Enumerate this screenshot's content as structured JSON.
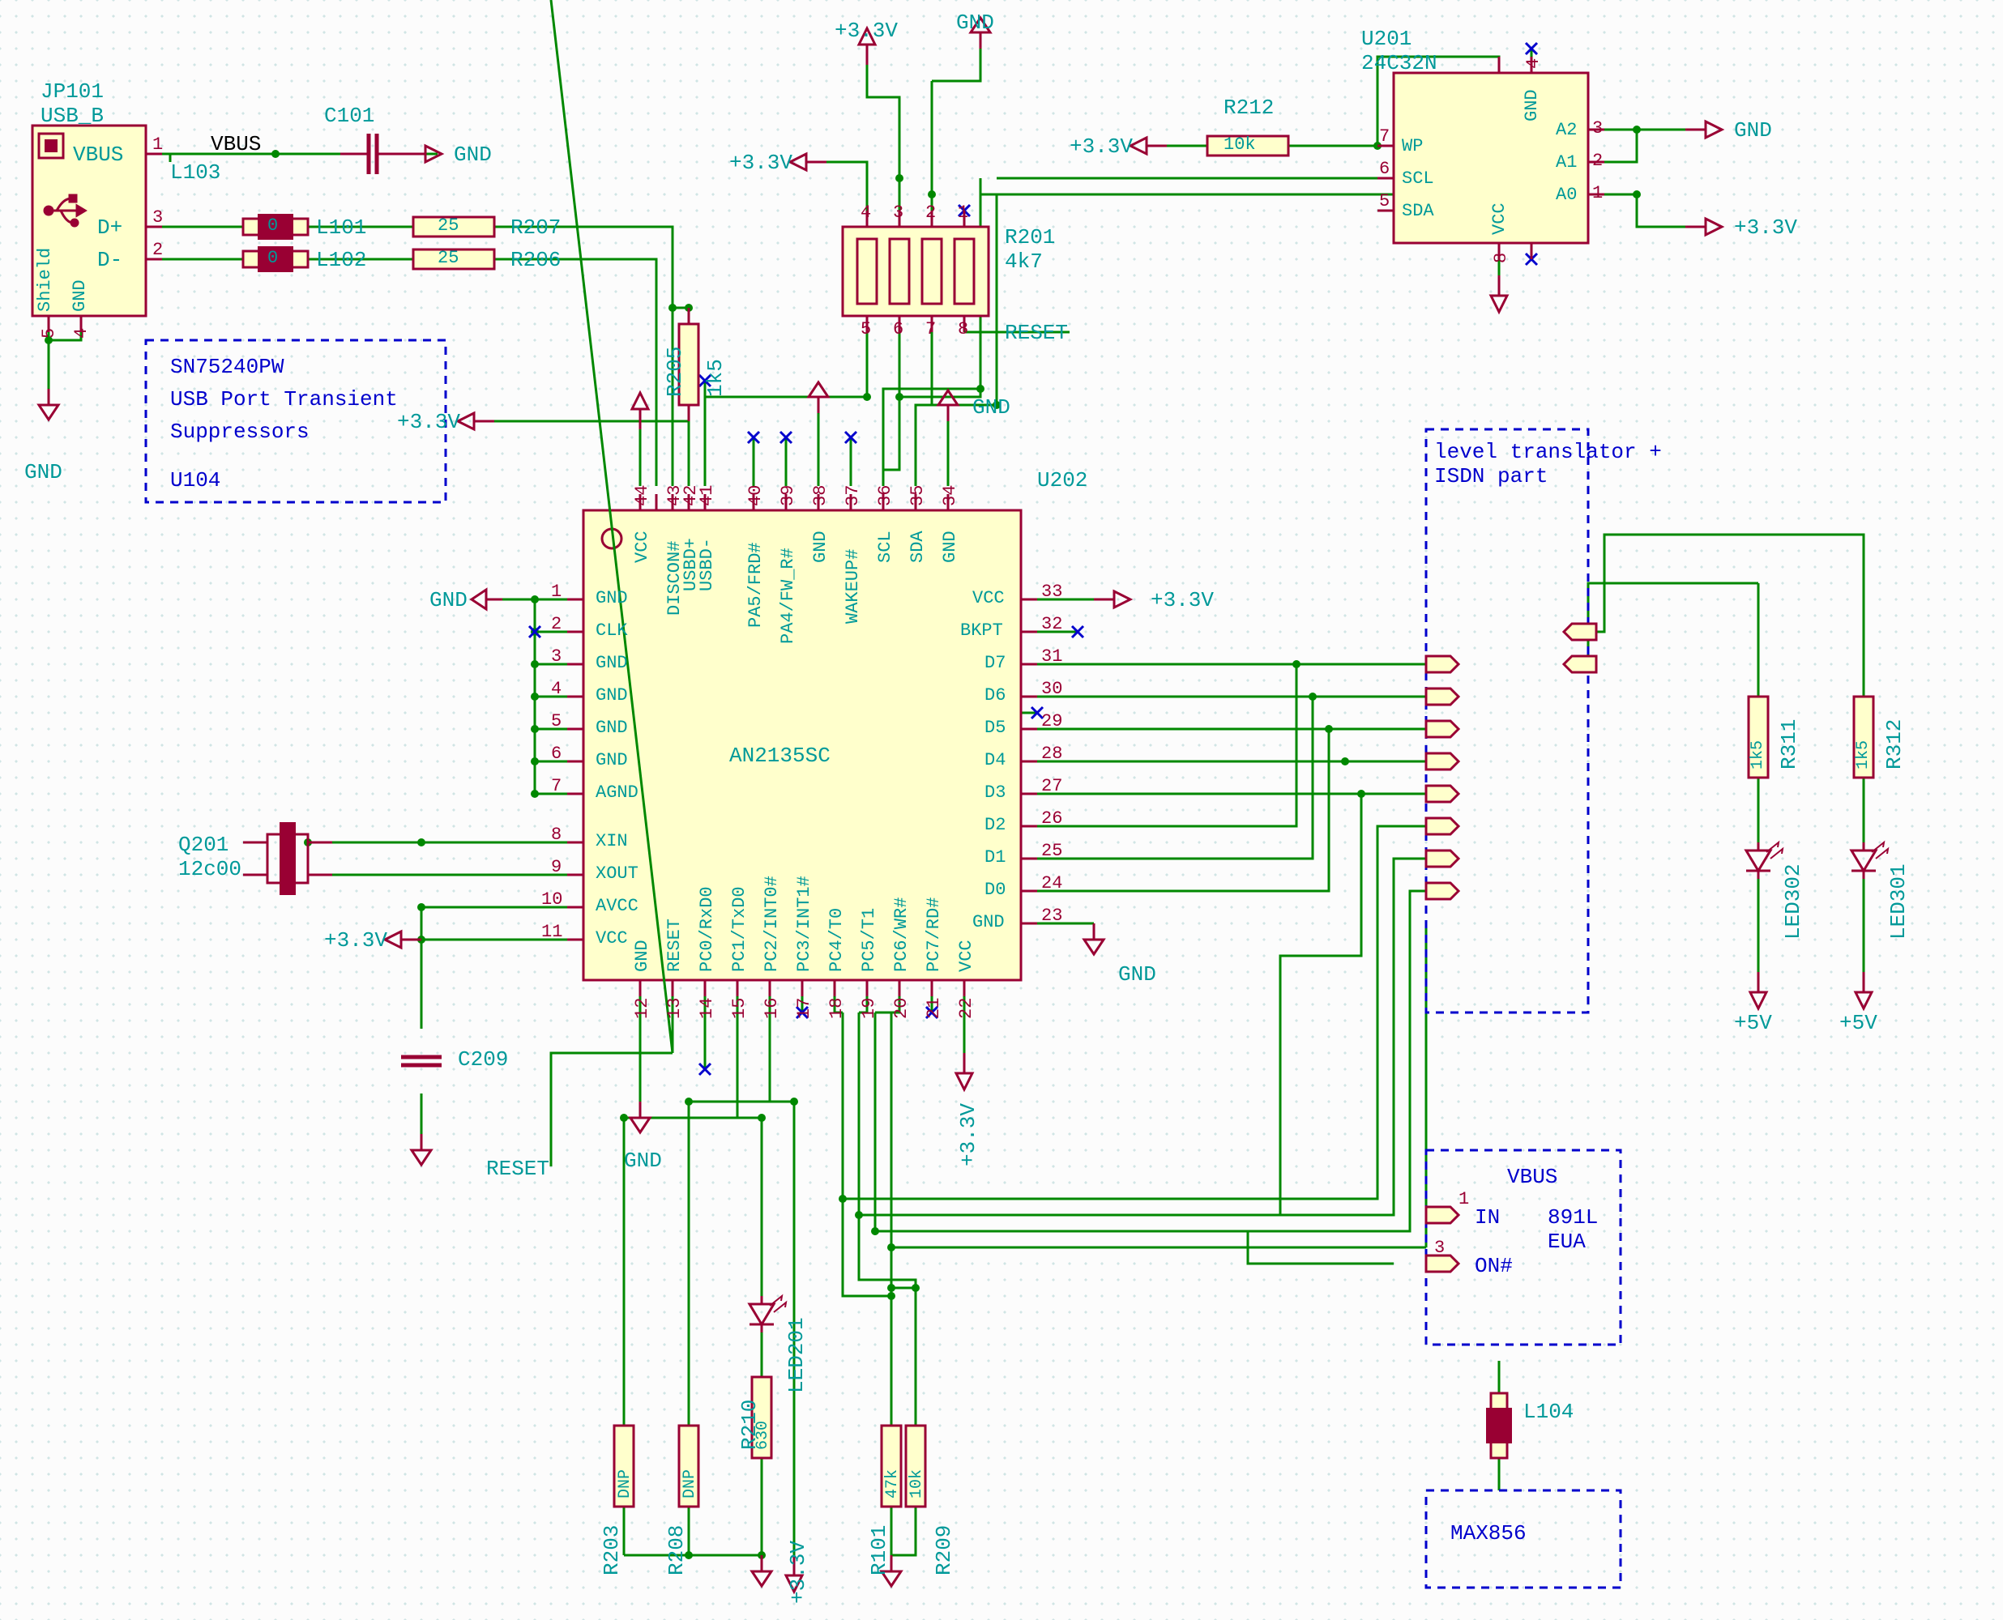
{
  "usb": {
    "ref": "JP101",
    "name": "USB_B",
    "pins": {
      "vbus": "VBUS",
      "dplus": "D+",
      "dminus": "D-",
      "shield": "Shield",
      "gnd": "GND"
    },
    "pinNums": {
      "vbus": "1",
      "dplus": "3",
      "dminus": "2",
      "shield": "5",
      "gnd": "4"
    },
    "gnd_label": "GND"
  },
  "nets": {
    "vbus": "VBUS",
    "reset": "RESET",
    "gnd": "GND",
    "v33": "+3.3V",
    "v5": "+5V"
  },
  "ferrites": {
    "l103": {
      "ref": "L103"
    },
    "l101": {
      "ref": "L101",
      "val": "0"
    },
    "l102": {
      "ref": "L102",
      "val": "0"
    },
    "l104": {
      "ref": "L104"
    }
  },
  "caps": {
    "c101": {
      "ref": "C101"
    },
    "c209": {
      "ref": "C209"
    }
  },
  "resistors": {
    "r207": {
      "ref": "R207",
      "val": "25"
    },
    "r206": {
      "ref": "R206",
      "val": "25"
    },
    "r205": {
      "ref": "R205",
      "val": "1k5"
    },
    "r212": {
      "ref": "R212",
      "val": "10k"
    },
    "r201": {
      "ref": "R201",
      "val": "4k7"
    },
    "r210": {
      "ref": "R210",
      "val": "630"
    },
    "r203": {
      "ref": "R203",
      "val": "DNP"
    },
    "r208": {
      "ref": "R208",
      "val": "DNP"
    },
    "r101": {
      "ref": "R101",
      "val": "47k"
    },
    "r209": {
      "ref": "R209",
      "val": "10k"
    },
    "r311": {
      "ref": "R311",
      "val": "1k5"
    },
    "r312": {
      "ref": "R312",
      "val": "1k5"
    }
  },
  "crystal": {
    "ref": "Q201",
    "val": "12c00"
  },
  "leds": {
    "led201": {
      "ref": "LED201"
    },
    "led302": {
      "ref": "LED302"
    },
    "led301": {
      "ref": "LED301"
    }
  },
  "u104_block": {
    "ref": "U104",
    "line1": "SN75240PW",
    "line2": "USB Port Transient",
    "line3": "Suppressors"
  },
  "level_block": {
    "line1": "level translator +",
    "line2": "ISDN part"
  },
  "u201": {
    "ref": "U201",
    "name": "24C32N",
    "pins": {
      "wp": {
        "name": "WP",
        "num": "7"
      },
      "scl": {
        "name": "SCL",
        "num": "6"
      },
      "sda": {
        "name": "SDA",
        "num": "5"
      },
      "vcc": {
        "name": "VCC",
        "num": "8"
      },
      "gnd": {
        "name": "GND",
        "num": "4"
      },
      "a0": {
        "name": "A0",
        "num": "1"
      },
      "a1": {
        "name": "A1",
        "num": "2"
      },
      "a2": {
        "name": "A2",
        "num": "3"
      }
    }
  },
  "u202": {
    "ref": "U202",
    "name": "AN2135SC",
    "top": {
      "p44": {
        "num": "44",
        "name": "VCC"
      },
      "p43": {
        "num": "43",
        "name": "DISCON#"
      },
      "p42": {
        "num": "42",
        "name": "USBD+"
      },
      "p41": {
        "num": "41",
        "name": "USBD-"
      },
      "p40": {
        "num": "40",
        "name": "PA5/FRD#"
      },
      "p39": {
        "num": "39",
        "name": "PA4/FW_R#"
      },
      "p38": {
        "num": "38",
        "name": "GND"
      },
      "p37": {
        "num": "37",
        "name": "WAKEUP#"
      },
      "p36": {
        "num": "36",
        "name": "SCL"
      },
      "p35": {
        "num": "35",
        "name": "SDA"
      },
      "p34": {
        "num": "34",
        "name": "GND"
      }
    },
    "left": {
      "p1": {
        "num": "1",
        "name": "GND"
      },
      "p2": {
        "num": "2",
        "name": "CLK"
      },
      "p3": {
        "num": "3",
        "name": "GND"
      },
      "p4": {
        "num": "4",
        "name": "GND"
      },
      "p5": {
        "num": "5",
        "name": "GND"
      },
      "p6": {
        "num": "6",
        "name": "GND"
      },
      "p7": {
        "num": "7",
        "name": "AGND"
      },
      "p8": {
        "num": "8",
        "name": "XIN"
      },
      "p9": {
        "num": "9",
        "name": "XOUT"
      },
      "p10": {
        "num": "10",
        "name": "AVCC"
      },
      "p11": {
        "num": "11",
        "name": "VCC"
      }
    },
    "right": {
      "p33": {
        "num": "33",
        "name": "VCC"
      },
      "p32": {
        "num": "32",
        "name": "BKPT"
      },
      "p31": {
        "num": "31",
        "name": "D7"
      },
      "p30": {
        "num": "30",
        "name": "D6"
      },
      "p29": {
        "num": "29",
        "name": "D5"
      },
      "p28": {
        "num": "28",
        "name": "D4"
      },
      "p27": {
        "num": "27",
        "name": "D3"
      },
      "p26": {
        "num": "26",
        "name": "D2"
      },
      "p25": {
        "num": "25",
        "name": "D1"
      },
      "p24": {
        "num": "24",
        "name": "D0"
      },
      "p23": {
        "num": "23",
        "name": "GND"
      }
    },
    "bottom": {
      "p12": {
        "num": "12",
        "name": "GND"
      },
      "p13": {
        "num": "13",
        "name": "RESET"
      },
      "p14": {
        "num": "14",
        "name": "PC0/RxD0"
      },
      "p15": {
        "num": "15",
        "name": "PC1/TxD0"
      },
      "p16": {
        "num": "16",
        "name": "PC2/INT0#"
      },
      "p17": {
        "num": "17",
        "name": "PC3/INT1#"
      },
      "p18": {
        "num": "18",
        "name": "PC4/T0"
      },
      "p19": {
        "num": "19",
        "name": "PC5/T1"
      },
      "p20": {
        "num": "20",
        "name": "PC6/WR#"
      },
      "p21": {
        "num": "21",
        "name": "PC7/RD#"
      },
      "p22": {
        "num": "22",
        "name": "VCC"
      }
    }
  },
  "eua_block": {
    "ref": "891L",
    "name": "EUA",
    "vbus": "VBUS",
    "in": {
      "name": "IN",
      "num": "1"
    },
    "on": {
      "name": "ON#",
      "num": "3"
    }
  },
  "max856_block": {
    "text": "MAX856"
  },
  "colors": {
    "wire": "#008800",
    "comp": "#990033",
    "text": "#009999",
    "fill": "#ffffcc",
    "blue": "#0000cc"
  },
  "chart_data": {
    "type": "schematic",
    "components": [
      {
        "ref": "JP101",
        "type": "connector",
        "value": "USB_B"
      },
      {
        "ref": "L101",
        "type": "ferrite",
        "value": "0"
      },
      {
        "ref": "L102",
        "type": "ferrite",
        "value": "0"
      },
      {
        "ref": "L103",
        "type": "ferrite",
        "value": ""
      },
      {
        "ref": "L104",
        "type": "ferrite",
        "value": ""
      },
      {
        "ref": "C101",
        "type": "capacitor",
        "value": ""
      },
      {
        "ref": "C209",
        "type": "capacitor",
        "value": ""
      },
      {
        "ref": "R101",
        "type": "resistor",
        "value": "47k"
      },
      {
        "ref": "R201",
        "type": "resistor_network",
        "value": "4k7"
      },
      {
        "ref": "R203",
        "type": "resistor",
        "value": "DNP"
      },
      {
        "ref": "R205",
        "type": "resistor",
        "value": "1k5"
      },
      {
        "ref": "R206",
        "type": "resistor",
        "value": "25"
      },
      {
        "ref": "R207",
        "type": "resistor",
        "value": "25"
      },
      {
        "ref": "R208",
        "type": "resistor",
        "value": "DNP"
      },
      {
        "ref": "R209",
        "type": "resistor",
        "value": "10k"
      },
      {
        "ref": "R210",
        "type": "resistor",
        "value": "630"
      },
      {
        "ref": "R212",
        "type": "resistor",
        "value": "10k"
      },
      {
        "ref": "R311",
        "type": "resistor",
        "value": "1k5"
      },
      {
        "ref": "R312",
        "type": "resistor",
        "value": "1k5"
      },
      {
        "ref": "Q201",
        "type": "crystal",
        "value": "12c00"
      },
      {
        "ref": "LED201",
        "type": "led",
        "value": ""
      },
      {
        "ref": "LED301",
        "type": "led",
        "value": ""
      },
      {
        "ref": "LED302",
        "type": "led",
        "value": ""
      },
      {
        "ref": "U104",
        "type": "ic",
        "value": "SN75240PW"
      },
      {
        "ref": "U201",
        "type": "ic",
        "value": "24C32N"
      },
      {
        "ref": "U202",
        "type": "ic",
        "value": "AN2135SC"
      },
      {
        "ref": "891L",
        "type": "ic",
        "value": "EUA"
      },
      {
        "ref": "MAX856",
        "type": "ic",
        "value": ""
      }
    ],
    "nets": [
      "VBUS",
      "GND",
      "+3.3V",
      "+5V",
      "RESET"
    ]
  }
}
